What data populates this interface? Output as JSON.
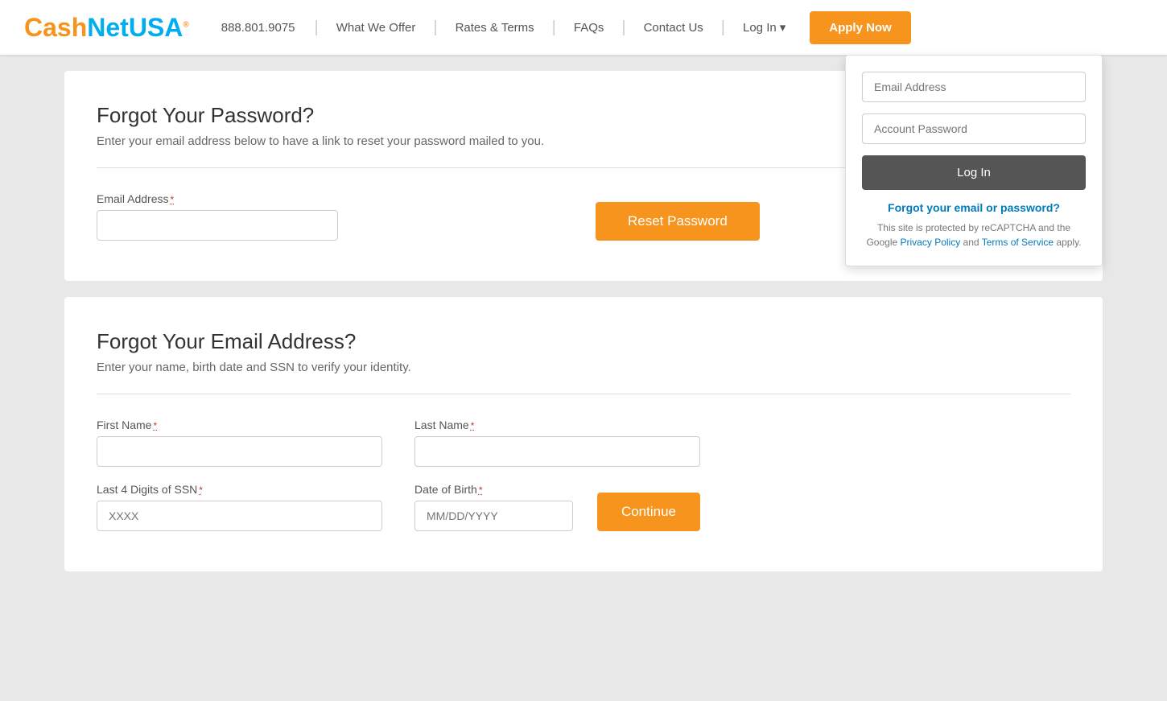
{
  "header": {
    "logo": {
      "cash": "Cash",
      "net": "Net",
      "usa": "USA",
      "dot": "®"
    },
    "phone": "888.801.9075",
    "nav": [
      {
        "id": "what-we-offer",
        "label": "What We Offer"
      },
      {
        "id": "rates-terms",
        "label": "Rates & Terms"
      },
      {
        "id": "faqs",
        "label": "FAQs"
      },
      {
        "id": "contact-us",
        "label": "Contact Us"
      }
    ],
    "login_label": "Log In",
    "login_arrow": "▾",
    "apply_label": "Apply Now"
  },
  "login_dropdown": {
    "email_placeholder": "Email Address",
    "password_placeholder": "Account Password",
    "login_button": "Log In",
    "forgot_link": "Forgot your email or password?",
    "recaptcha_text": "This site is protected by reCAPTCHA and the Google",
    "privacy_policy": "Privacy Policy",
    "and": "and",
    "terms_of_service": "Terms of Service",
    "apply_text": "apply."
  },
  "forgot_password": {
    "title": "Forgot Your Password?",
    "subtitle": "Enter your email address below to have a link to reset your password mailed to you.",
    "email_label": "Email Address",
    "required_indicator": "*",
    "email_placeholder": "",
    "reset_button": "Reset Password"
  },
  "forgot_email": {
    "title": "Forgot Your Email Address?",
    "subtitle": "Enter your name, birth date and SSN to verify your identity.",
    "first_name_label": "First Name",
    "last_name_label": "Last Name",
    "ssn_label": "Last 4 Digits of SSN",
    "dob_label": "Date of Birth",
    "required_indicator": "*",
    "ssn_placeholder": "XXXX",
    "dob_placeholder": "MM/DD/YYYY",
    "first_name_placeholder": "",
    "last_name_placeholder": "",
    "continue_button": "Continue"
  }
}
